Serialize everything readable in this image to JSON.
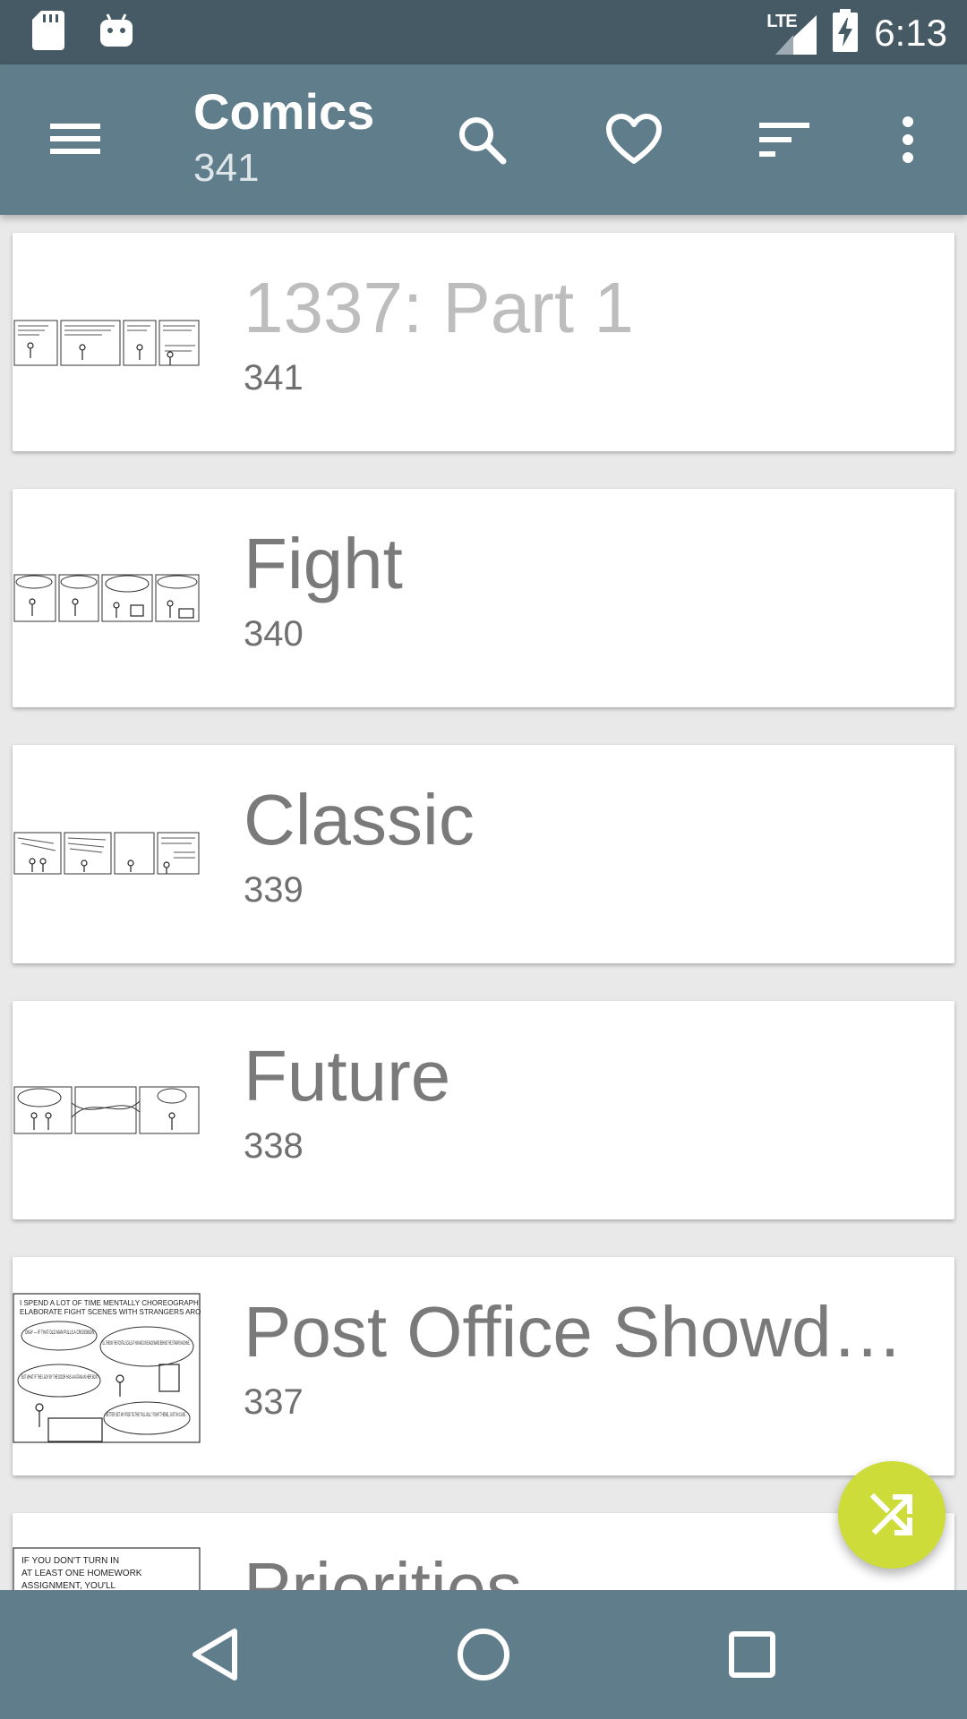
{
  "status_bar": {
    "time": "6:13",
    "network_label": "LTE",
    "icons": [
      "sd-card-icon",
      "android-debug-icon",
      "signal-icon",
      "battery-charging-icon"
    ]
  },
  "app_bar": {
    "title": "Comics",
    "subtitle": "341",
    "icons": [
      "menu-icon",
      "search-icon",
      "favorite-icon",
      "sort-icon",
      "more-vert-icon"
    ]
  },
  "comics": [
    {
      "title": "1337: Part 1",
      "number": "341"
    },
    {
      "title": "Fight",
      "number": "340"
    },
    {
      "title": "Classic",
      "number": "339"
    },
    {
      "title": "Future",
      "number": "338"
    },
    {
      "title": "Post Office Showdown",
      "number": "337"
    },
    {
      "title": "Priorities",
      "number": ""
    }
  ],
  "thumbnails": {
    "post_office": {
      "line1": "I SPEND A LOT OF TIME MENTALLY CHOREOGRAPHING",
      "line2": "ELABORATE FIGHT SCENES WITH STRANGERS AROUND ME.",
      "bubble1": "OKAY — IF THAT OLD MAN PULLS A CROSSBOW,",
      "bubble2": "I'LL THROW THE POSTAL SCALE AT HIM AND DIVE BACKWARD BEHIND THE STAMPS MACHINE.",
      "bubble3": "BUT WHAT IF THE LADY BY THE DOOR HAS A KATANA IN HER BOX?",
      "bubble4": "BETTER SET MY IPOD TO THE \"KILL BILL\" FIGHT THEME, JUST IN CASE."
    },
    "priorities": {
      "line1": "IF YOU DON'T TURN IN",
      "line2": "AT LEAST ONE HOMEWORK",
      "line3": "ASSIGNMENT, YOU'LL"
    }
  },
  "fab": {
    "icon": "shuffle-icon"
  },
  "nav_bar": {
    "icons": [
      "back-icon",
      "home-icon",
      "recents-icon"
    ]
  },
  "colors": {
    "status_bar": "#455a64",
    "app_bar": "#607d8b",
    "fab": "#cddc39",
    "background": "#e9e9e9"
  }
}
